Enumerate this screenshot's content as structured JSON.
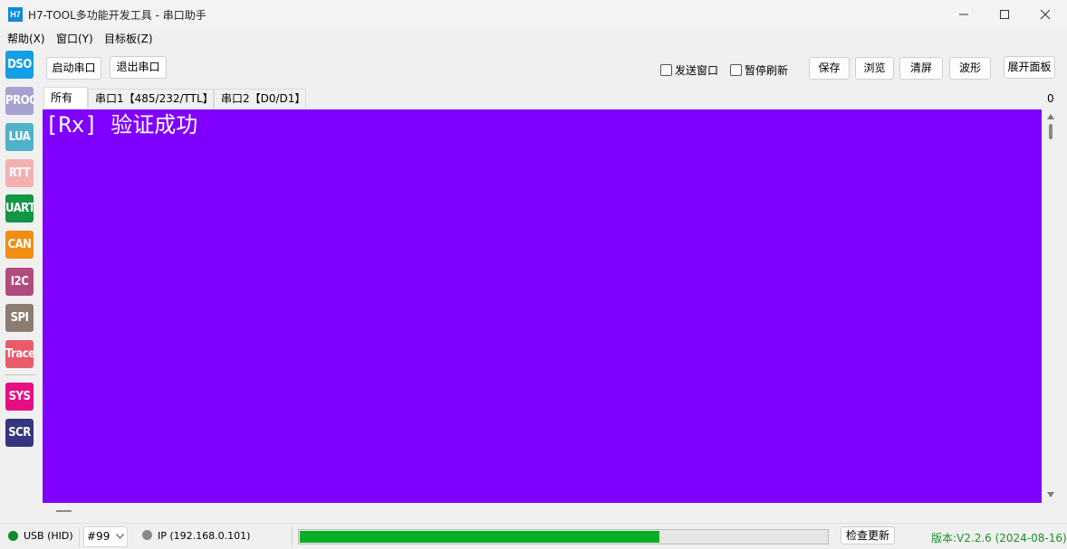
{
  "window": {
    "icon_label": "H7",
    "title": "H7-TOOL多功能开发工具 - 串口助手"
  },
  "menu": {
    "items": [
      "帮助(X)",
      "窗口(Y)",
      "目标板(Z)"
    ]
  },
  "sidebar": {
    "buttons": [
      {
        "label": "DSO",
        "color": "#139ee6"
      },
      {
        "label": "PROG",
        "color": "#a6a2cf"
      },
      {
        "label": "LUA",
        "color": "#4fb2c9"
      },
      {
        "label": "RTT",
        "color": "#f4b0b0"
      },
      {
        "label": "UART",
        "color": "#139546"
      },
      {
        "label": "CAN",
        "color": "#f18d12"
      },
      {
        "label": "I2C",
        "color": "#b14b80"
      },
      {
        "label": "SPI",
        "color": "#8a7d73"
      },
      {
        "label": "Trace",
        "color": "#ea5b6a"
      },
      {
        "label": "SYS",
        "color": "#e80e82"
      },
      {
        "label": "SCR",
        "color": "#36357f"
      }
    ]
  },
  "toolbar": {
    "start_port": "启动串口",
    "exit_port": "退出串口",
    "send_window": "发送窗口",
    "pause_refresh": "暂停刷新",
    "save": "保存",
    "browse": "浏览",
    "clear": "清屏",
    "waveform": "波形",
    "expand_panel": "展开面板"
  },
  "tabs": [
    {
      "label": "所有",
      "active": true
    },
    {
      "label": "串口1【485/232/TTL】",
      "active": false
    },
    {
      "label": "串口2【D0/D1】",
      "active": false
    }
  ],
  "tab_counter": "0",
  "console": {
    "background": "#7f00ff",
    "text": "[Rx] 验证成功"
  },
  "status": {
    "usb": "USB (HID)",
    "usb_color": "#118a2c",
    "device": "#99",
    "ip": "IP (192.168.0.101)",
    "ip_color": "#8a8a8a",
    "progress_fraction": 0.68,
    "progress_color": "#06b025",
    "check_update": "检查更新",
    "version": "版本:V2.2.6 (2024-08-16)"
  }
}
